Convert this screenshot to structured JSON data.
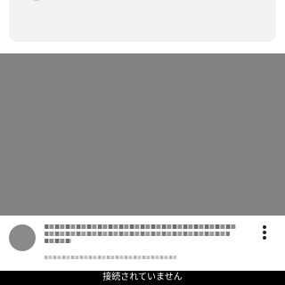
{
  "status_bar": {
    "message": "接続されていません"
  },
  "icons": {
    "more": "more-vert-icon"
  },
  "colors": {
    "thumbnail": "#838383",
    "status_bar_bg": "#000000",
    "status_bar_text": "#ffffff",
    "card_bg": "#f2f2f2"
  }
}
